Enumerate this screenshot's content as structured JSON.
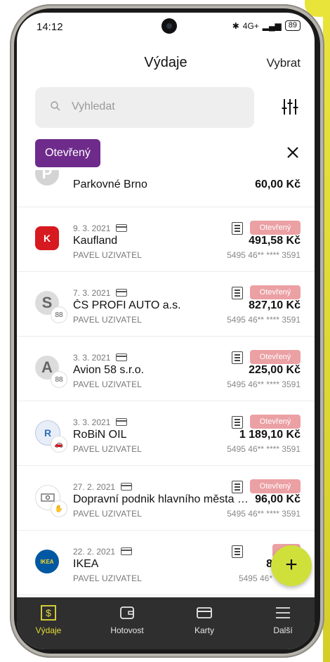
{
  "status_bar": {
    "time": "14:12",
    "network": "4G+",
    "battery": "89"
  },
  "header": {
    "title": "Výdaje",
    "select_label": "Vybrat"
  },
  "search": {
    "placeholder": "Vyhledat"
  },
  "filter_chip": {
    "label": "Otevřený"
  },
  "transactions": [
    {
      "date": "",
      "merchant": "Parkovné Brno",
      "user": "",
      "amount": "60,00 Kč",
      "status": "",
      "card": "",
      "logo_text": "P",
      "logo_color": "#cfcfcf"
    },
    {
      "date": "9. 3. 2021",
      "merchant": "Kaufland",
      "user": "PAVEL UZIVATEL",
      "amount": "491,58 Kč",
      "status": "Otevřený",
      "card": "5495 46** **** 3591",
      "logo_text": "K",
      "logo_color": "#d71920"
    },
    {
      "date": "7. 3. 2021",
      "merchant": "ČS PROFI AUTO a.s.",
      "user": "PAVEL UZIVATEL",
      "amount": "827,10 Kč",
      "status": "Otevřený",
      "card": "5495 46** **** 3591",
      "logo_text": "S",
      "logo_color": "#d9d9d9"
    },
    {
      "date": "3. 3. 2021",
      "merchant": "Avion 58 s.r.o.",
      "user": "PAVEL UZIVATEL",
      "amount": "225,00 Kč",
      "status": "Otevřený",
      "card": "5495 46** **** 3591",
      "logo_text": "A",
      "logo_color": "#d9d9d9"
    },
    {
      "date": "3. 3. 2021",
      "merchant": "RoBiN OIL",
      "user": "PAVEL UZIVATEL",
      "amount": "1 189,10 Kč",
      "status": "Otevřený",
      "card": "5495 46** **** 3591",
      "logo_text": "R",
      "logo_color": "#2f6fb8"
    },
    {
      "date": "27. 2. 2021",
      "merchant": "Dopravní podnik hlavního města Pr...",
      "user": "PAVEL UZIVATEL",
      "amount": "96,00 Kč",
      "status": "Otevřený",
      "card": "5495 46** **** 3591",
      "logo_text": "",
      "logo_color": "#ffffff"
    },
    {
      "date": "22. 2. 2021",
      "merchant": "IKEA",
      "user": "PAVEL UZIVATEL",
      "amount": "8",
      "status": "Ot",
      "card": "5495 46*",
      "logo_text": "IKEA",
      "logo_color": "#0058a3"
    }
  ],
  "fab": {
    "label": "+"
  },
  "bottom_nav": [
    {
      "label": "Výdaje",
      "icon": "dollar-square-icon",
      "active": true
    },
    {
      "label": "Hotovost",
      "icon": "wallet-icon",
      "active": false
    },
    {
      "label": "Karty",
      "icon": "card-icon",
      "active": false
    },
    {
      "label": "Další",
      "icon": "menu-icon",
      "active": false
    }
  ],
  "colors": {
    "accent": "#6e2b8b",
    "status_open": "#eba0a4",
    "fab": "#cfe03a",
    "nav_active": "#e5dc3a"
  }
}
